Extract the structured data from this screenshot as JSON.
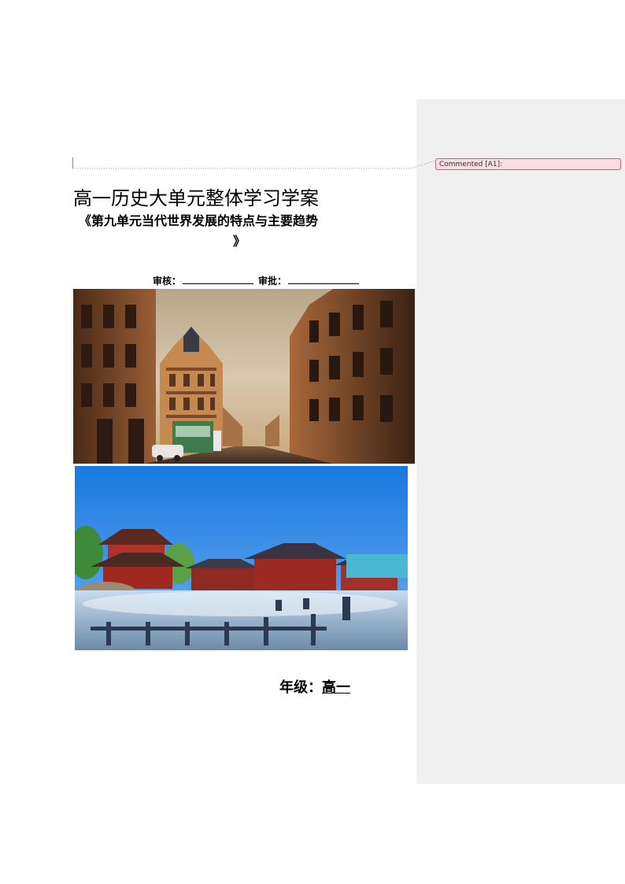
{
  "document": {
    "title": "高一历史大单元整体学习学案",
    "subtitle": "《第九单元当代世界发展的特点与主要趋势",
    "subtitle_close": "》",
    "review_label": "审核：",
    "approve_label": "审批：",
    "grade_label": "年级：",
    "grade_value": "高一"
  },
  "comment": {
    "label": "Commented [A1]:"
  },
  "colors": {
    "comment_pane": "#f0f0f0",
    "comment_bubble_fill": "#fcdce3",
    "comment_bubble_border": "#d45a78"
  }
}
